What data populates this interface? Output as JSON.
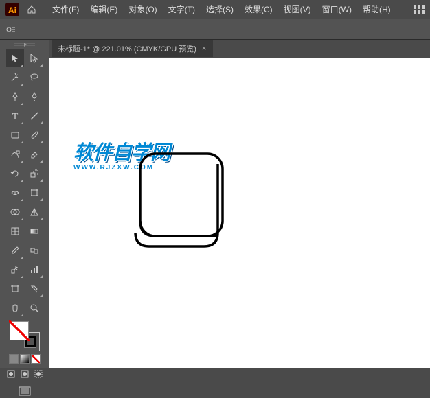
{
  "app": {
    "name": "Ai"
  },
  "menu": {
    "items": [
      "文件(F)",
      "编辑(E)",
      "对象(O)",
      "文字(T)",
      "选择(S)",
      "效果(C)",
      "视图(V)",
      "窗口(W)",
      "帮助(H)"
    ]
  },
  "document": {
    "tab_title": "未标题-1* @ 221.01% (CMYK/GPU 预览)",
    "close": "×"
  },
  "watermark": {
    "main": "软件自学网",
    "sub": "WWW.RJZXW.COM"
  },
  "tools": {
    "selection": "selection-tool",
    "direct": "direct-selection-tool",
    "wand": "magic-wand-tool",
    "lasso": "lasso-tool",
    "pen": "pen-tool",
    "curvature": "curvature-tool",
    "type": "type-tool",
    "line": "line-segment-tool",
    "rectangle": "rectangle-tool",
    "brush": "paintbrush-tool",
    "shaper": "shaper-tool",
    "eraser": "eraser-tool",
    "rotate": "rotate-tool",
    "scale": "scale-tool",
    "width": "width-tool",
    "free": "free-transform-tool",
    "shapebuilder": "shape-builder-tool",
    "perspective": "perspective-grid-tool",
    "mesh": "mesh-tool",
    "gradient": "gradient-tool",
    "eyedropper": "eyedropper-tool",
    "blend": "blend-tool",
    "symbol": "symbol-sprayer-tool",
    "graph": "column-graph-tool",
    "artboard": "artboard-tool",
    "slice": "slice-tool",
    "hand": "hand-tool",
    "zoom": "zoom-tool"
  }
}
